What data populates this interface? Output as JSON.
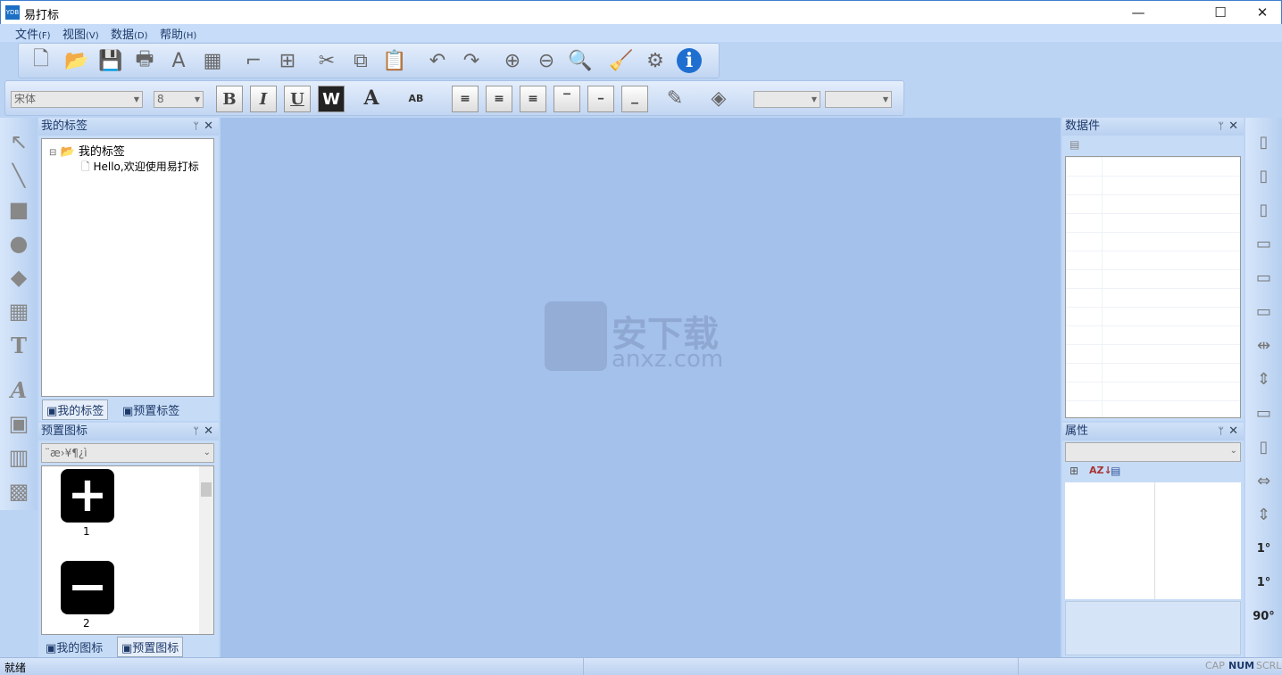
{
  "window": {
    "title": "易打标",
    "logo_text": "YDB",
    "controls": [
      "—",
      "☐",
      "✕"
    ]
  },
  "menu": [
    {
      "label": "文件",
      "key": "(F)"
    },
    {
      "label": "视图",
      "key": "(V)"
    },
    {
      "label": "数据",
      "key": "(D)"
    },
    {
      "label": "帮助",
      "key": "(H)"
    }
  ],
  "toolbar1": [
    {
      "name": "new-file",
      "glyph": "🗋"
    },
    {
      "name": "open-folder",
      "glyph": "📂"
    },
    {
      "name": "save",
      "glyph": "💾"
    },
    {
      "name": "print",
      "glyph": "🖶"
    },
    {
      "name": "page-setup",
      "glyph": "A"
    },
    {
      "name": "excel-import",
      "glyph": "▦"
    },
    {
      "name": "ruler",
      "glyph": "⌐"
    },
    {
      "name": "grid",
      "glyph": "⊞"
    },
    {
      "name": "cut",
      "glyph": "✂"
    },
    {
      "name": "copy",
      "glyph": "⧉"
    },
    {
      "name": "paste",
      "glyph": "📋"
    },
    {
      "name": "undo",
      "glyph": "↶"
    },
    {
      "name": "redo",
      "glyph": "↷"
    },
    {
      "name": "zoom-in",
      "glyph": "⊕"
    },
    {
      "name": "zoom-out",
      "glyph": "⊖"
    },
    {
      "name": "zoom-fit",
      "glyph": "🔍"
    },
    {
      "name": "clean",
      "glyph": "🧹"
    },
    {
      "name": "settings",
      "glyph": "⚙"
    },
    {
      "name": "info",
      "glyph": "i"
    }
  ],
  "toolbar2": {
    "font": "宋体",
    "size": "8",
    "bold": "B",
    "italic": "I",
    "underline": "U",
    "reverse": "W",
    "font_color": "A",
    "highlight": "AB",
    "combo1": "",
    "combo2": ""
  },
  "left_tools": [
    {
      "name": "pointer",
      "glyph": "↖"
    },
    {
      "name": "line",
      "glyph": "╲"
    },
    {
      "name": "rectangle",
      "glyph": "■"
    },
    {
      "name": "ellipse",
      "glyph": "●"
    },
    {
      "name": "diamond",
      "glyph": "◆"
    },
    {
      "name": "table",
      "glyph": "▦"
    },
    {
      "name": "text",
      "glyph": "T"
    },
    {
      "name": "art-text",
      "glyph": "A"
    },
    {
      "name": "image",
      "glyph": "▣"
    },
    {
      "name": "barcode",
      "glyph": "▥"
    },
    {
      "name": "qrcode",
      "glyph": "▩"
    }
  ],
  "labels_panel": {
    "title": "我的标签",
    "root": "我的标签",
    "item": "Hello,欢迎使用易打标",
    "tabs": [
      "我的标签",
      "预置标签"
    ]
  },
  "icons_panel": {
    "title": "预置图标",
    "category": "¨æ›¥¶¿ì",
    "icons": [
      {
        "glyph": "+",
        "label": "1"
      },
      {
        "glyph": "−",
        "label": "2"
      }
    ],
    "tabs": [
      "我的图标",
      "预置图标"
    ]
  },
  "data_panel": {
    "title": "数据件"
  },
  "props_panel": {
    "title": "属性",
    "select": ""
  },
  "canvas": {
    "watermark": "安下载",
    "watermark_sub": "anxz.com"
  },
  "right_tools": [
    "align-top",
    "align-middle",
    "align-bottom",
    "align-left",
    "align-center",
    "align-right",
    "space-h",
    "space-v",
    "same-width",
    "same-height",
    "h-distribute",
    "v-distribute",
    "rotate-ccw-1",
    "rotate-cw-1",
    "rotate-90"
  ],
  "right_tool_glyphs": [
    "▯",
    "▯",
    "▯",
    "▭",
    "▭",
    "▭",
    "⇹",
    "⇕",
    "▭",
    "▯",
    "⇔",
    "⇕",
    "1°",
    "1°",
    "90°"
  ],
  "status": {
    "text": "就绪",
    "cap": "CAP",
    "num": "NUM",
    "scrl": "SCRL"
  }
}
